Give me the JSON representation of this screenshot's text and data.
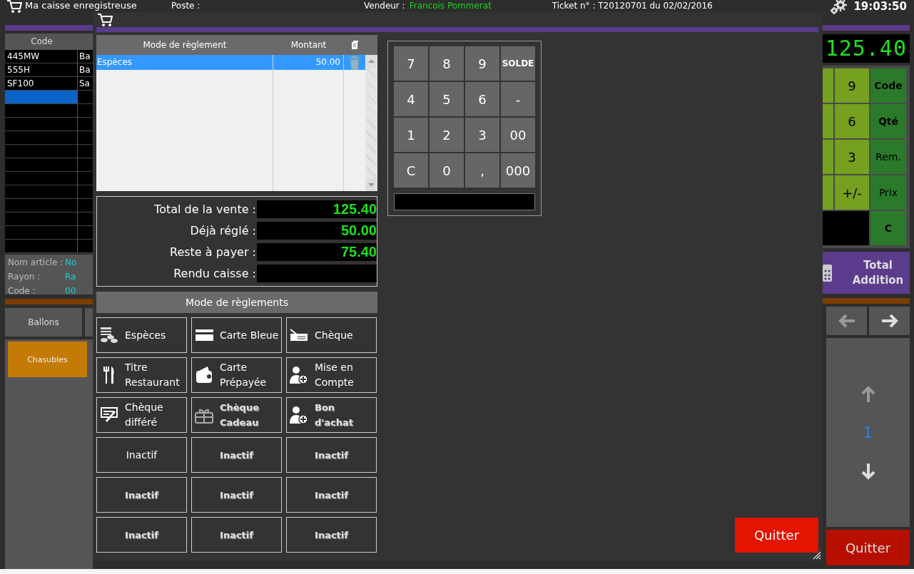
{
  "top_bar": {
    "title": "Ma caisse enregistreuse",
    "poste_label": "Poste :",
    "vendeur_label": "Vendeur :",
    "vendeur": "Francois Pommerat",
    "ticket": "Ticket n° : T20120701 du 02/02/2016",
    "time": "19:03:50"
  },
  "articles": {
    "columns": [
      "Code"
    ],
    "rows": [
      {
        "code": "445MW",
        "column_2": "Ba"
      },
      {
        "code": "555H",
        "column_2": "Ba"
      },
      {
        "code": "SF100",
        "column_2": "Sa"
      }
    ]
  },
  "article_info": [
    {
      "label": "Nom article :",
      "value": "No"
    },
    {
      "label": "Rayon :",
      "value": "Ra"
    },
    {
      "label": "Code :",
      "value": "00"
    }
  ],
  "categories": [
    {
      "label": "Ballons"
    }
  ],
  "tiles": [
    {
      "label": "Chasubles"
    }
  ],
  "display": "125.40",
  "side_keypad": [
    {
      "digit": "9",
      "function": "Code",
      "bold": true
    },
    {
      "digit": "6",
      "function": "Qté",
      "bold": true
    },
    {
      "digit": "3",
      "function": "Rem.",
      "bold": false
    },
    {
      "digit": "+/-",
      "function": "Prix",
      "bold": false
    },
    {
      "function": "C",
      "bold": true
    }
  ],
  "total_button": "Total Addition",
  "page": "1",
  "quit": "Quitter",
  "dialog": {
    "payments": {
      "columns": [
        "Mode de règlement",
        "Montant"
      ],
      "rows": [
        {
          "mode": "Espèces",
          "amount": "50.00",
          "selected": true
        }
      ]
    },
    "totals": [
      {
        "label": "Total de la vente :",
        "value": "125.40"
      },
      {
        "label": "Déjà réglé :",
        "value": "50.00"
      },
      {
        "label": "Reste à payer :",
        "value": "75.40"
      },
      {
        "label": "Rendu caisse :"
      }
    ],
    "methods_title": "Mode de règlements",
    "methods": [
      {
        "label": "Espèces",
        "kind": "cash",
        "disabled": false
      },
      {
        "label": "Carte Bleue",
        "kind": "card",
        "disabled": false
      },
      {
        "label": "Chèque",
        "kind": "cheque",
        "disabled": false
      },
      {
        "label": "Titre\nRestaurant",
        "kind": "voucher",
        "disabled": false
      },
      {
        "label": "Carte\nPrépayée",
        "kind": "prepaid",
        "disabled": false
      },
      {
        "label": "Mise en\nCompte",
        "kind": "account",
        "disabled": false
      },
      {
        "label": "Chèque\ndifféré",
        "kind": "deferred",
        "disabled": false
      },
      {
        "label": "Chèque\nCadeau",
        "kind": "gift",
        "disabled": true
      },
      {
        "label": "Bon\nd'achat",
        "kind": "account",
        "disabled": true
      },
      {
        "label": "Inactif",
        "kind": "inactive",
        "disabled": false
      },
      {
        "label": "Inactif",
        "kind": "inactive",
        "disabled": true
      },
      {
        "label": "Inactif",
        "kind": "inactive",
        "disabled": true
      },
      {
        "label": "Inactif",
        "kind": "inactive",
        "disabled": true
      },
      {
        "label": "Inactif",
        "kind": "inactive",
        "disabled": true
      },
      {
        "label": "Inactif",
        "kind": "inactive",
        "disabled": true
      },
      {
        "label": "Inactif",
        "kind": "inactive",
        "disabled": true
      },
      {
        "label": "Inactif",
        "kind": "inactive",
        "disabled": true
      },
      {
        "label": "Inactif",
        "kind": "inactive",
        "disabled": true
      }
    ],
    "keypad": [
      "7",
      "8",
      "9",
      "SOLDE",
      "4",
      "5",
      "6",
      "-",
      "1",
      "2",
      "3",
      "00",
      "C",
      "0",
      ",",
      "000"
    ],
    "quit": "Quitter"
  }
}
